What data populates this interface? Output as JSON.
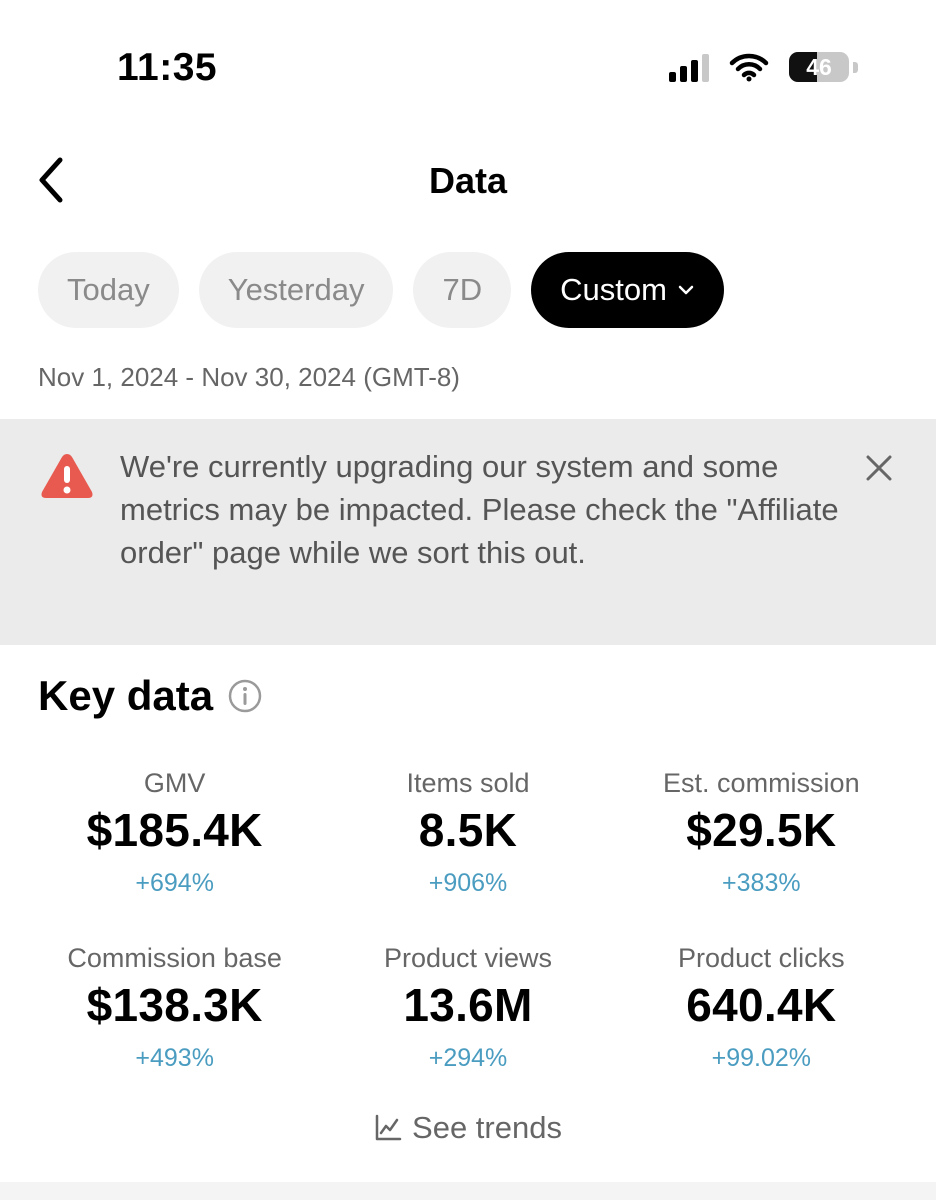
{
  "status_bar": {
    "time": "11:35",
    "battery_level": "46"
  },
  "header": {
    "title": "Data"
  },
  "tabs": [
    {
      "label": "Today",
      "active": false
    },
    {
      "label": "Yesterday",
      "active": false
    },
    {
      "label": "7D",
      "active": false
    },
    {
      "label": "Custom",
      "active": true
    }
  ],
  "date_range": "Nov 1, 2024 - Nov 30, 2024 (GMT-8)",
  "banner": {
    "text": "We're currently upgrading our system and some metrics may be impacted. Please check the \"Affiliate order\" page while we sort this out.",
    "icon": "warning-icon",
    "icon_color": "#e85a4f"
  },
  "key_data": {
    "title": "Key data",
    "metrics": [
      {
        "label": "GMV",
        "value": "$185.4K",
        "change": "+694%"
      },
      {
        "label": "Items sold",
        "value": "8.5K",
        "change": "+906%"
      },
      {
        "label": "Est. commission",
        "value": "$29.5K",
        "change": "+383%"
      },
      {
        "label": "Commission base",
        "value": "$138.3K",
        "change": "+493%"
      },
      {
        "label": "Product views",
        "value": "13.6M",
        "change": "+294%"
      },
      {
        "label": "Product clicks",
        "value": "640.4K",
        "change": "+99.02%"
      }
    ],
    "change_color": "#4a9cc0"
  },
  "see_trends": "See trends"
}
